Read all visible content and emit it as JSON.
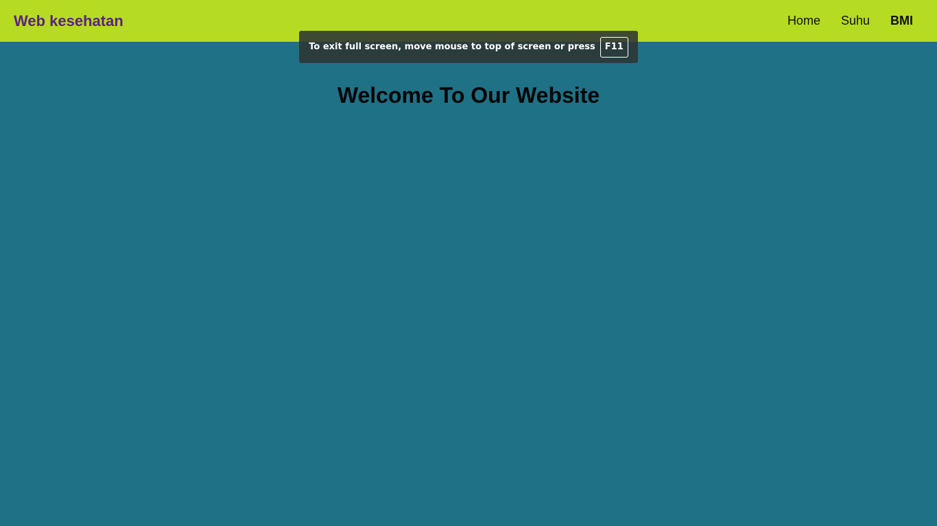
{
  "navbar": {
    "brand": "Web kesehatan",
    "links": [
      {
        "label": "Home",
        "active": false
      },
      {
        "label": "Suhu",
        "active": false
      },
      {
        "label": "BMI",
        "active": true
      }
    ]
  },
  "fullscreen_notice": {
    "message": "To exit full screen, move mouse to top of screen or press",
    "key": "F11"
  },
  "main": {
    "heading": "Welcome To Our Website"
  },
  "colors": {
    "navbar_bg": "#b5db22",
    "brand_text": "#5b2282",
    "page_bg": "#1f7186",
    "notice_bg": "#2d3436"
  }
}
